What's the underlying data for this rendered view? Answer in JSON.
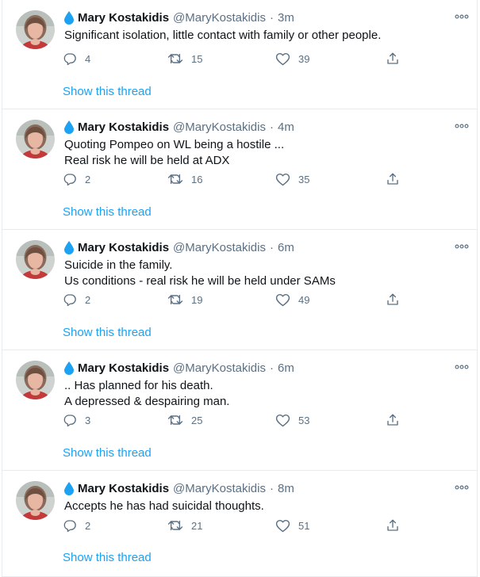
{
  "colors": {
    "accent": "#1da1f2",
    "secondary": "#5b7083",
    "text": "#0f1419",
    "border": "#e6ecf0"
  },
  "icons": {
    "verified": "water-drop-icon",
    "more": "more-dots-icon",
    "reply": "reply-icon",
    "retweet": "retweet-icon",
    "like": "heart-icon",
    "share": "share-icon"
  },
  "tweets": [
    {
      "author": "Mary Kostakidis",
      "handle": "@MaryKostakidis",
      "separator": "·",
      "time": "3m",
      "lines": [
        "Significant isolation, little contact with family or other people."
      ],
      "replies": "4",
      "retweets": "15",
      "likes": "39",
      "thread_link": "Show this thread"
    },
    {
      "author": "Mary Kostakidis",
      "handle": "@MaryKostakidis",
      "separator": "·",
      "time": "4m",
      "lines": [
        "Quoting Pompeo on WL being a hostile ...",
        "Real risk he will be held at ADX"
      ],
      "replies": "2",
      "retweets": "16",
      "likes": "35",
      "thread_link": "Show this thread"
    },
    {
      "author": "Mary Kostakidis",
      "handle": "@MaryKostakidis",
      "separator": "·",
      "time": "6m",
      "lines": [
        "Suicide in the family.",
        "Us conditions - real risk he will be held under SAMs"
      ],
      "replies": "2",
      "retweets": "19",
      "likes": "49",
      "thread_link": "Show this thread"
    },
    {
      "author": "Mary Kostakidis",
      "handle": "@MaryKostakidis",
      "separator": "·",
      "time": "6m",
      "lines": [
        ".. Has planned for his death.",
        "A depressed & despairing man."
      ],
      "replies": "3",
      "retweets": "25",
      "likes": "53",
      "thread_link": "Show this thread"
    },
    {
      "author": "Mary Kostakidis",
      "handle": "@MaryKostakidis",
      "separator": "·",
      "time": "8m",
      "lines": [
        "Accepts he has had suicidal thoughts."
      ],
      "replies": "2",
      "retweets": "21",
      "likes": "51",
      "thread_link": "Show this thread"
    }
  ]
}
